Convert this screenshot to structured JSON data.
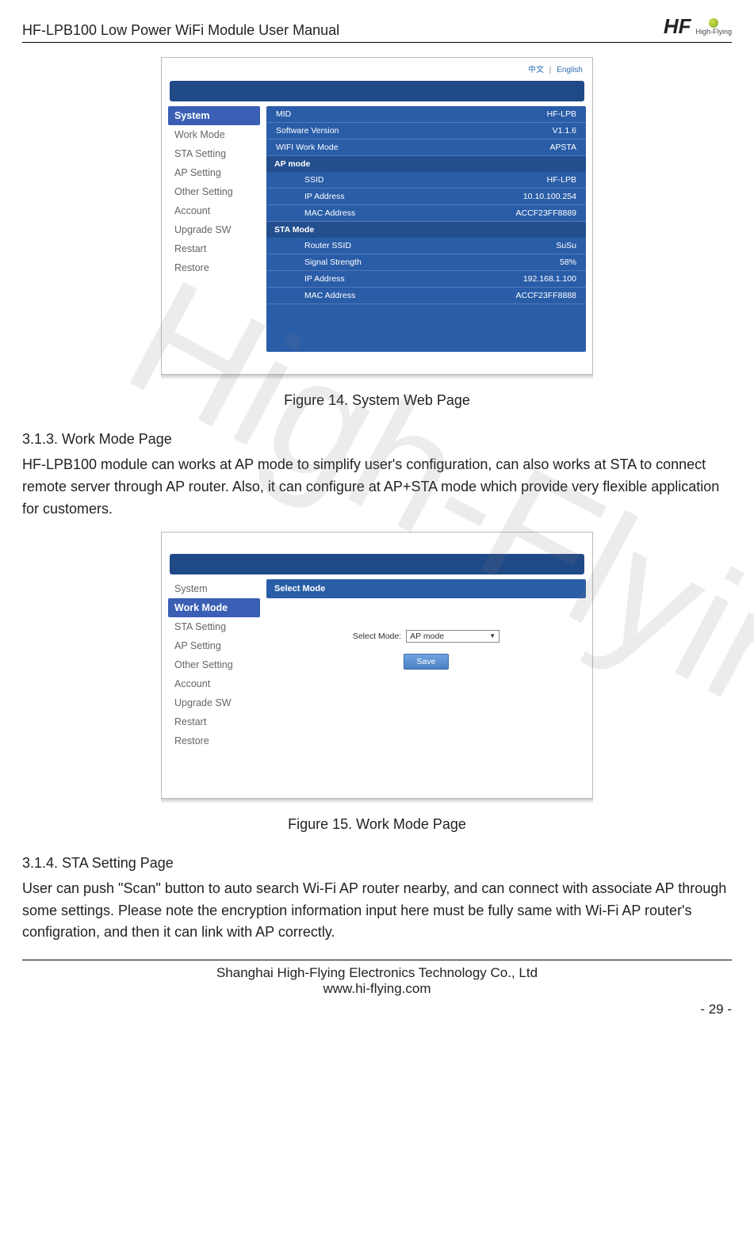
{
  "header": {
    "title": "HF-LPB100 Low Power WiFi Module User Manual",
    "brand_text": "HF",
    "brand_sub": "High-Flying"
  },
  "watermark": "High-Flying",
  "fig14": {
    "lang_cn": "中文",
    "lang_sep": "|",
    "lang_en": "English",
    "sidebar": [
      "System",
      "Work Mode",
      "STA Setting",
      "AP Setting",
      "Other Setting",
      "Account",
      "Upgrade SW",
      "Restart",
      "Restore"
    ],
    "rows_top": [
      {
        "k": "MID",
        "v": "HF-LPB"
      },
      {
        "k": "Software Version",
        "v": "V1.1.6"
      },
      {
        "k": "WIFI Work Mode",
        "v": "APSTA"
      }
    ],
    "sub_ap": "AP mode",
    "rows_ap": [
      {
        "k": "SSID",
        "v": "HF-LPB"
      },
      {
        "k": "IP Address",
        "v": "10.10.100.254"
      },
      {
        "k": "MAC Address",
        "v": "ACCF23FF8889"
      }
    ],
    "sub_sta": "STA Mode",
    "rows_sta": [
      {
        "k": "Router SSID",
        "v": "SuSu"
      },
      {
        "k": "Signal Strength",
        "v": "58%"
      },
      {
        "k": "IP Address",
        "v": "192.168.1.100"
      },
      {
        "k": "MAC Address",
        "v": "ACCF23FF8888"
      }
    ],
    "caption": "Figure 14.    System Web Page"
  },
  "section313": {
    "heading": "3.1.3.    Work Mode Page",
    "para": "HF-LPB100 module can works at AP mode to simplify user's configuration, can also works at STA to connect remote server through AP router. Also, it can configure at AP+STA mode which provide very flexible application for customers."
  },
  "fig15": {
    "sidebar": [
      "System",
      "Work Mode",
      "STA Setting",
      "AP Setting",
      "Other Setting",
      "Account",
      "Upgrade SW",
      "Restart",
      "Restore"
    ],
    "panel_title": "Select Mode",
    "label": "Select Mode:",
    "select_value": "AP mode",
    "save": "Save",
    "caption": "Figure 15.    Work Mode Page"
  },
  "section314": {
    "heading": "3.1.4.    STA Setting Page",
    "para": "User can push \"Scan\" button to auto search Wi-Fi AP router nearby, and can connect with associate AP through some settings. Please note the encryption information input here must be fully same with Wi-Fi AP router's configration, and then it can link with AP correctly."
  },
  "footer": {
    "company": "Shanghai High-Flying Electronics Technology Co., Ltd",
    "url": "www.hi-flying.com",
    "page": "- 29 -"
  }
}
